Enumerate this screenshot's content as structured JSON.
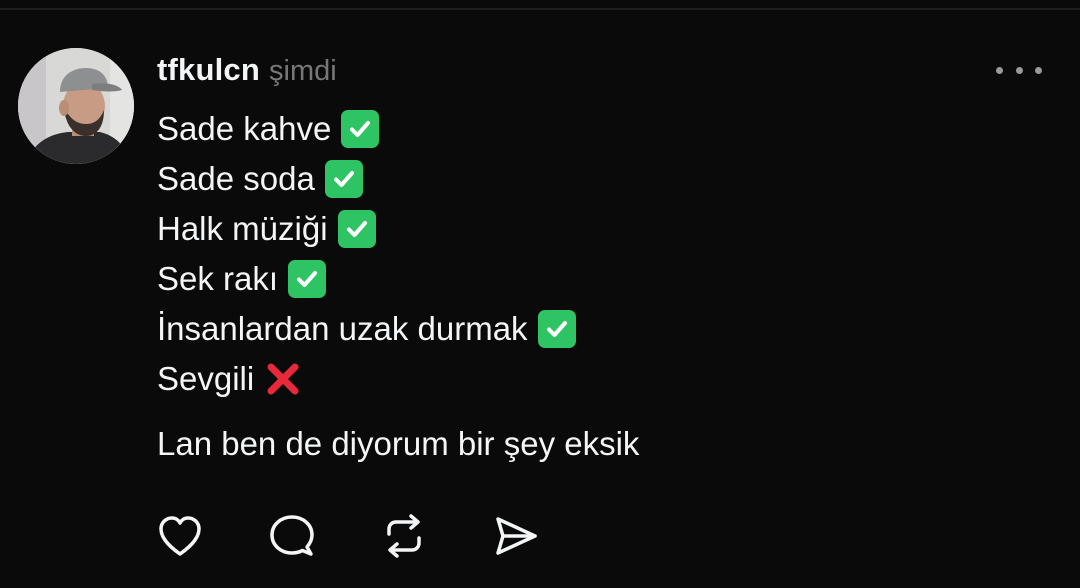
{
  "post": {
    "author": {
      "username": "tfkulcn",
      "avatar_icon": "profile-photo"
    },
    "timestamp": "şimdi",
    "menu_icon": "more-options-icon",
    "lines": [
      {
        "text": "Sade kahve",
        "emoji": "check-mark-button"
      },
      {
        "text": "Sade soda",
        "emoji": "check-mark-button"
      },
      {
        "text": "Halk müziği",
        "emoji": "check-mark-button"
      },
      {
        "text": "Sek rakı",
        "emoji": "check-mark-button"
      },
      {
        "text": "İnsanlardan uzak durmak",
        "emoji": "check-mark-button"
      },
      {
        "text": "Sevgili",
        "emoji": "cross-mark"
      }
    ],
    "closing_line": "Lan ben de diyorum bir şey eksik",
    "actions": [
      {
        "name": "like",
        "icon": "heart-icon"
      },
      {
        "name": "comment",
        "icon": "comment-bubble-icon"
      },
      {
        "name": "repost",
        "icon": "repost-icon"
      },
      {
        "name": "share",
        "icon": "send-icon"
      }
    ]
  },
  "colors": {
    "background": "#0a0a0a",
    "text": "#f3f5f7",
    "muted": "#777777",
    "check_green": "#2fc463",
    "cross_red": "#e8293b"
  }
}
